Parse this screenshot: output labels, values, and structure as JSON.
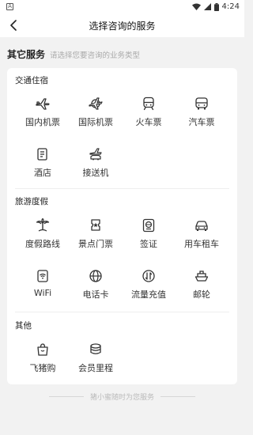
{
  "status_bar": {
    "time": "4:24",
    "app_indicator": "A"
  },
  "header": {
    "title": "选择咨询的服务"
  },
  "section": {
    "title": "其它服务",
    "subtitle": "请选择您要咨询的业务类型"
  },
  "groups": [
    {
      "title": "交通住宿",
      "items": [
        {
          "label": "国内机票",
          "icon": "airplane-icon"
        },
        {
          "label": "国际机票",
          "icon": "airplane-globe-icon"
        },
        {
          "label": "火车票",
          "icon": "train-icon"
        },
        {
          "label": "汽车票",
          "icon": "bus-icon"
        },
        {
          "label": "酒店",
          "icon": "hotel-icon"
        },
        {
          "label": "接送机",
          "icon": "airport-transfer-icon"
        }
      ]
    },
    {
      "title": "旅游度假",
      "items": [
        {
          "label": "度假路线",
          "icon": "palm-tree-icon"
        },
        {
          "label": "景点门票",
          "icon": "ticket-icon"
        },
        {
          "label": "签证",
          "icon": "passport-icon"
        },
        {
          "label": "用车租车",
          "icon": "car-icon"
        },
        {
          "label": "WiFi",
          "icon": "wifi-card-icon"
        },
        {
          "label": "电话卡",
          "icon": "globe-icon"
        },
        {
          "label": "流量充值",
          "icon": "data-recharge-icon"
        },
        {
          "label": "邮轮",
          "icon": "cruise-ship-icon"
        }
      ]
    },
    {
      "title": "其他",
      "items": [
        {
          "label": "飞猪购",
          "icon": "shopping-bag-icon"
        },
        {
          "label": "会员里程",
          "icon": "coins-icon"
        }
      ]
    }
  ],
  "footer": {
    "text": "猪小蜜随时为您服务"
  }
}
